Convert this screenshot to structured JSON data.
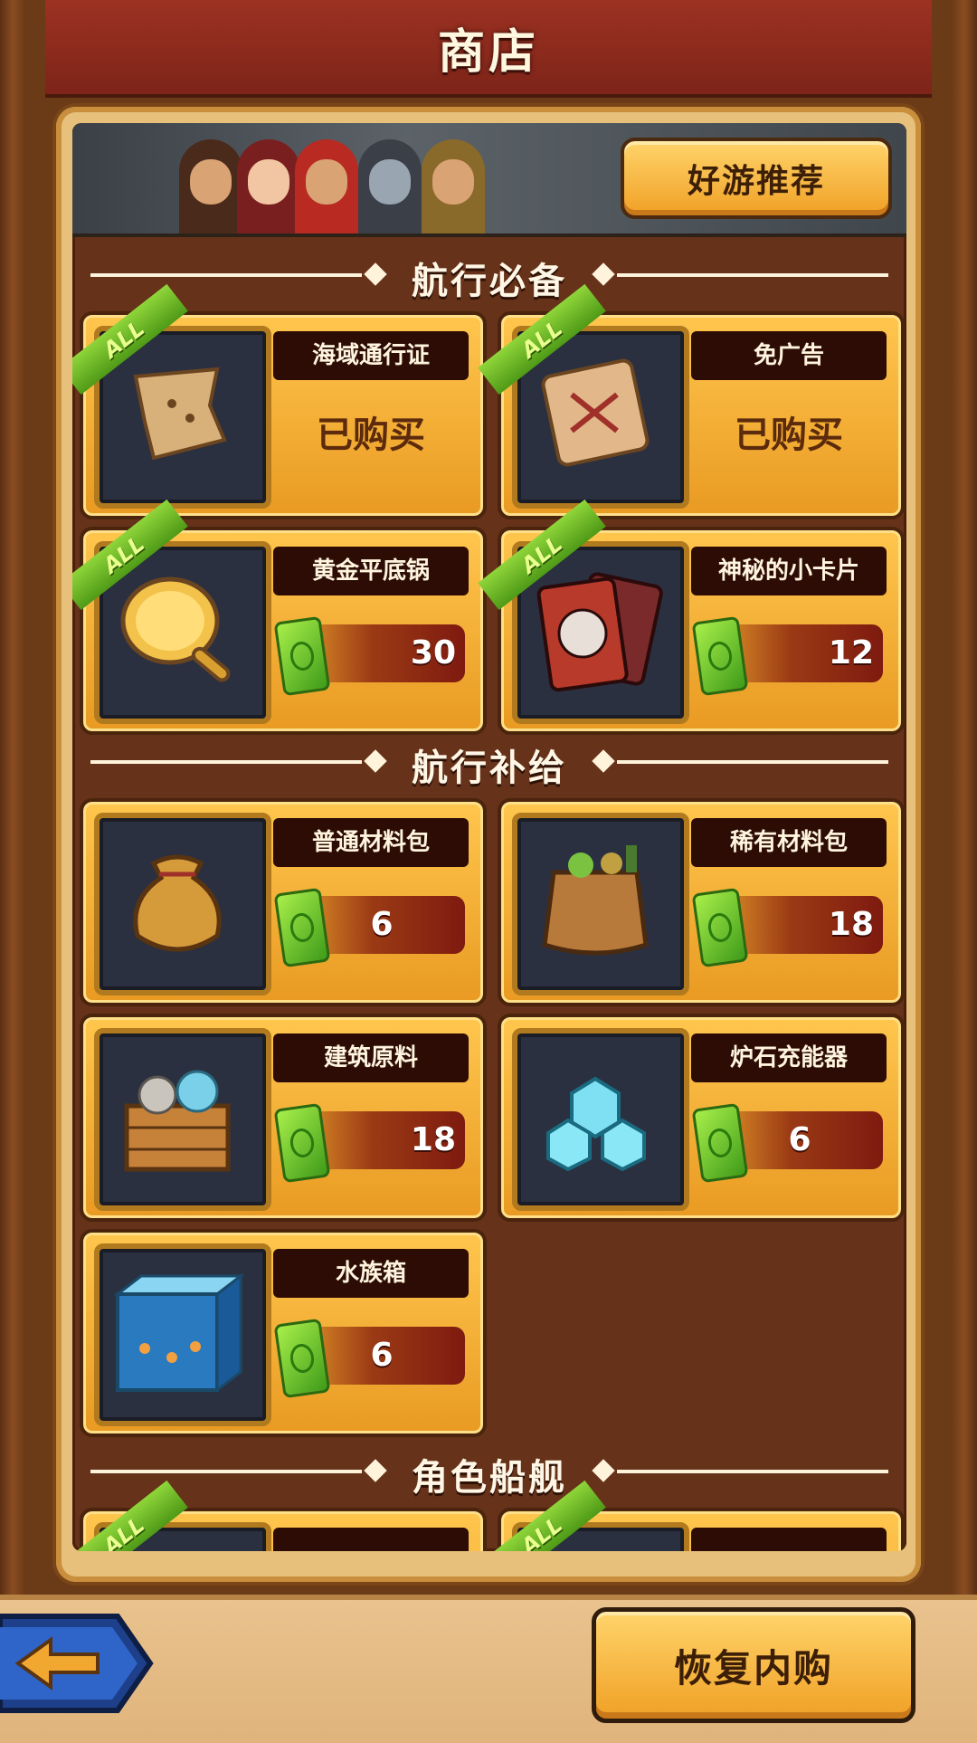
{
  "header": {
    "title": "商店"
  },
  "banner": {
    "recommend_label": "好游推荐"
  },
  "sections": [
    {
      "title": "航行必备",
      "items": [
        {
          "name": "海域通行证",
          "status": "已购买",
          "badge": "ALL",
          "icon": "map-scroll-icon"
        },
        {
          "name": "免广告",
          "status": "已购买",
          "badge": "ALL",
          "icon": "treasure-map-icon"
        },
        {
          "name": "黄金平底锅",
          "price": "30",
          "badge": "ALL",
          "icon": "golden-pan-icon"
        },
        {
          "name": "神秘的小卡片",
          "price": "12",
          "badge": "ALL",
          "icon": "dragon-card-icon"
        }
      ]
    },
    {
      "title": "航行补给",
      "items": [
        {
          "name": "普通材料包",
          "price": "6",
          "icon": "material-bag-icon"
        },
        {
          "name": "稀有材料包",
          "price": "18",
          "icon": "rare-bag-icon"
        },
        {
          "name": "建筑原料",
          "price": "18",
          "icon": "building-crate-icon"
        },
        {
          "name": "炉石充能器",
          "price": "6",
          "icon": "crystal-icon"
        },
        {
          "name": "水族箱",
          "price": "6",
          "icon": "aquarium-icon"
        }
      ]
    },
    {
      "title": "角色船舰",
      "items": [
        {
          "name": "",
          "badge": "ALL"
        },
        {
          "name": "",
          "badge": "ALL"
        }
      ]
    }
  ],
  "footer": {
    "restore_label": "恢复内购"
  },
  "colors": {
    "accent": "#f0a025",
    "panel": "#663219",
    "header": "#9c3222"
  }
}
